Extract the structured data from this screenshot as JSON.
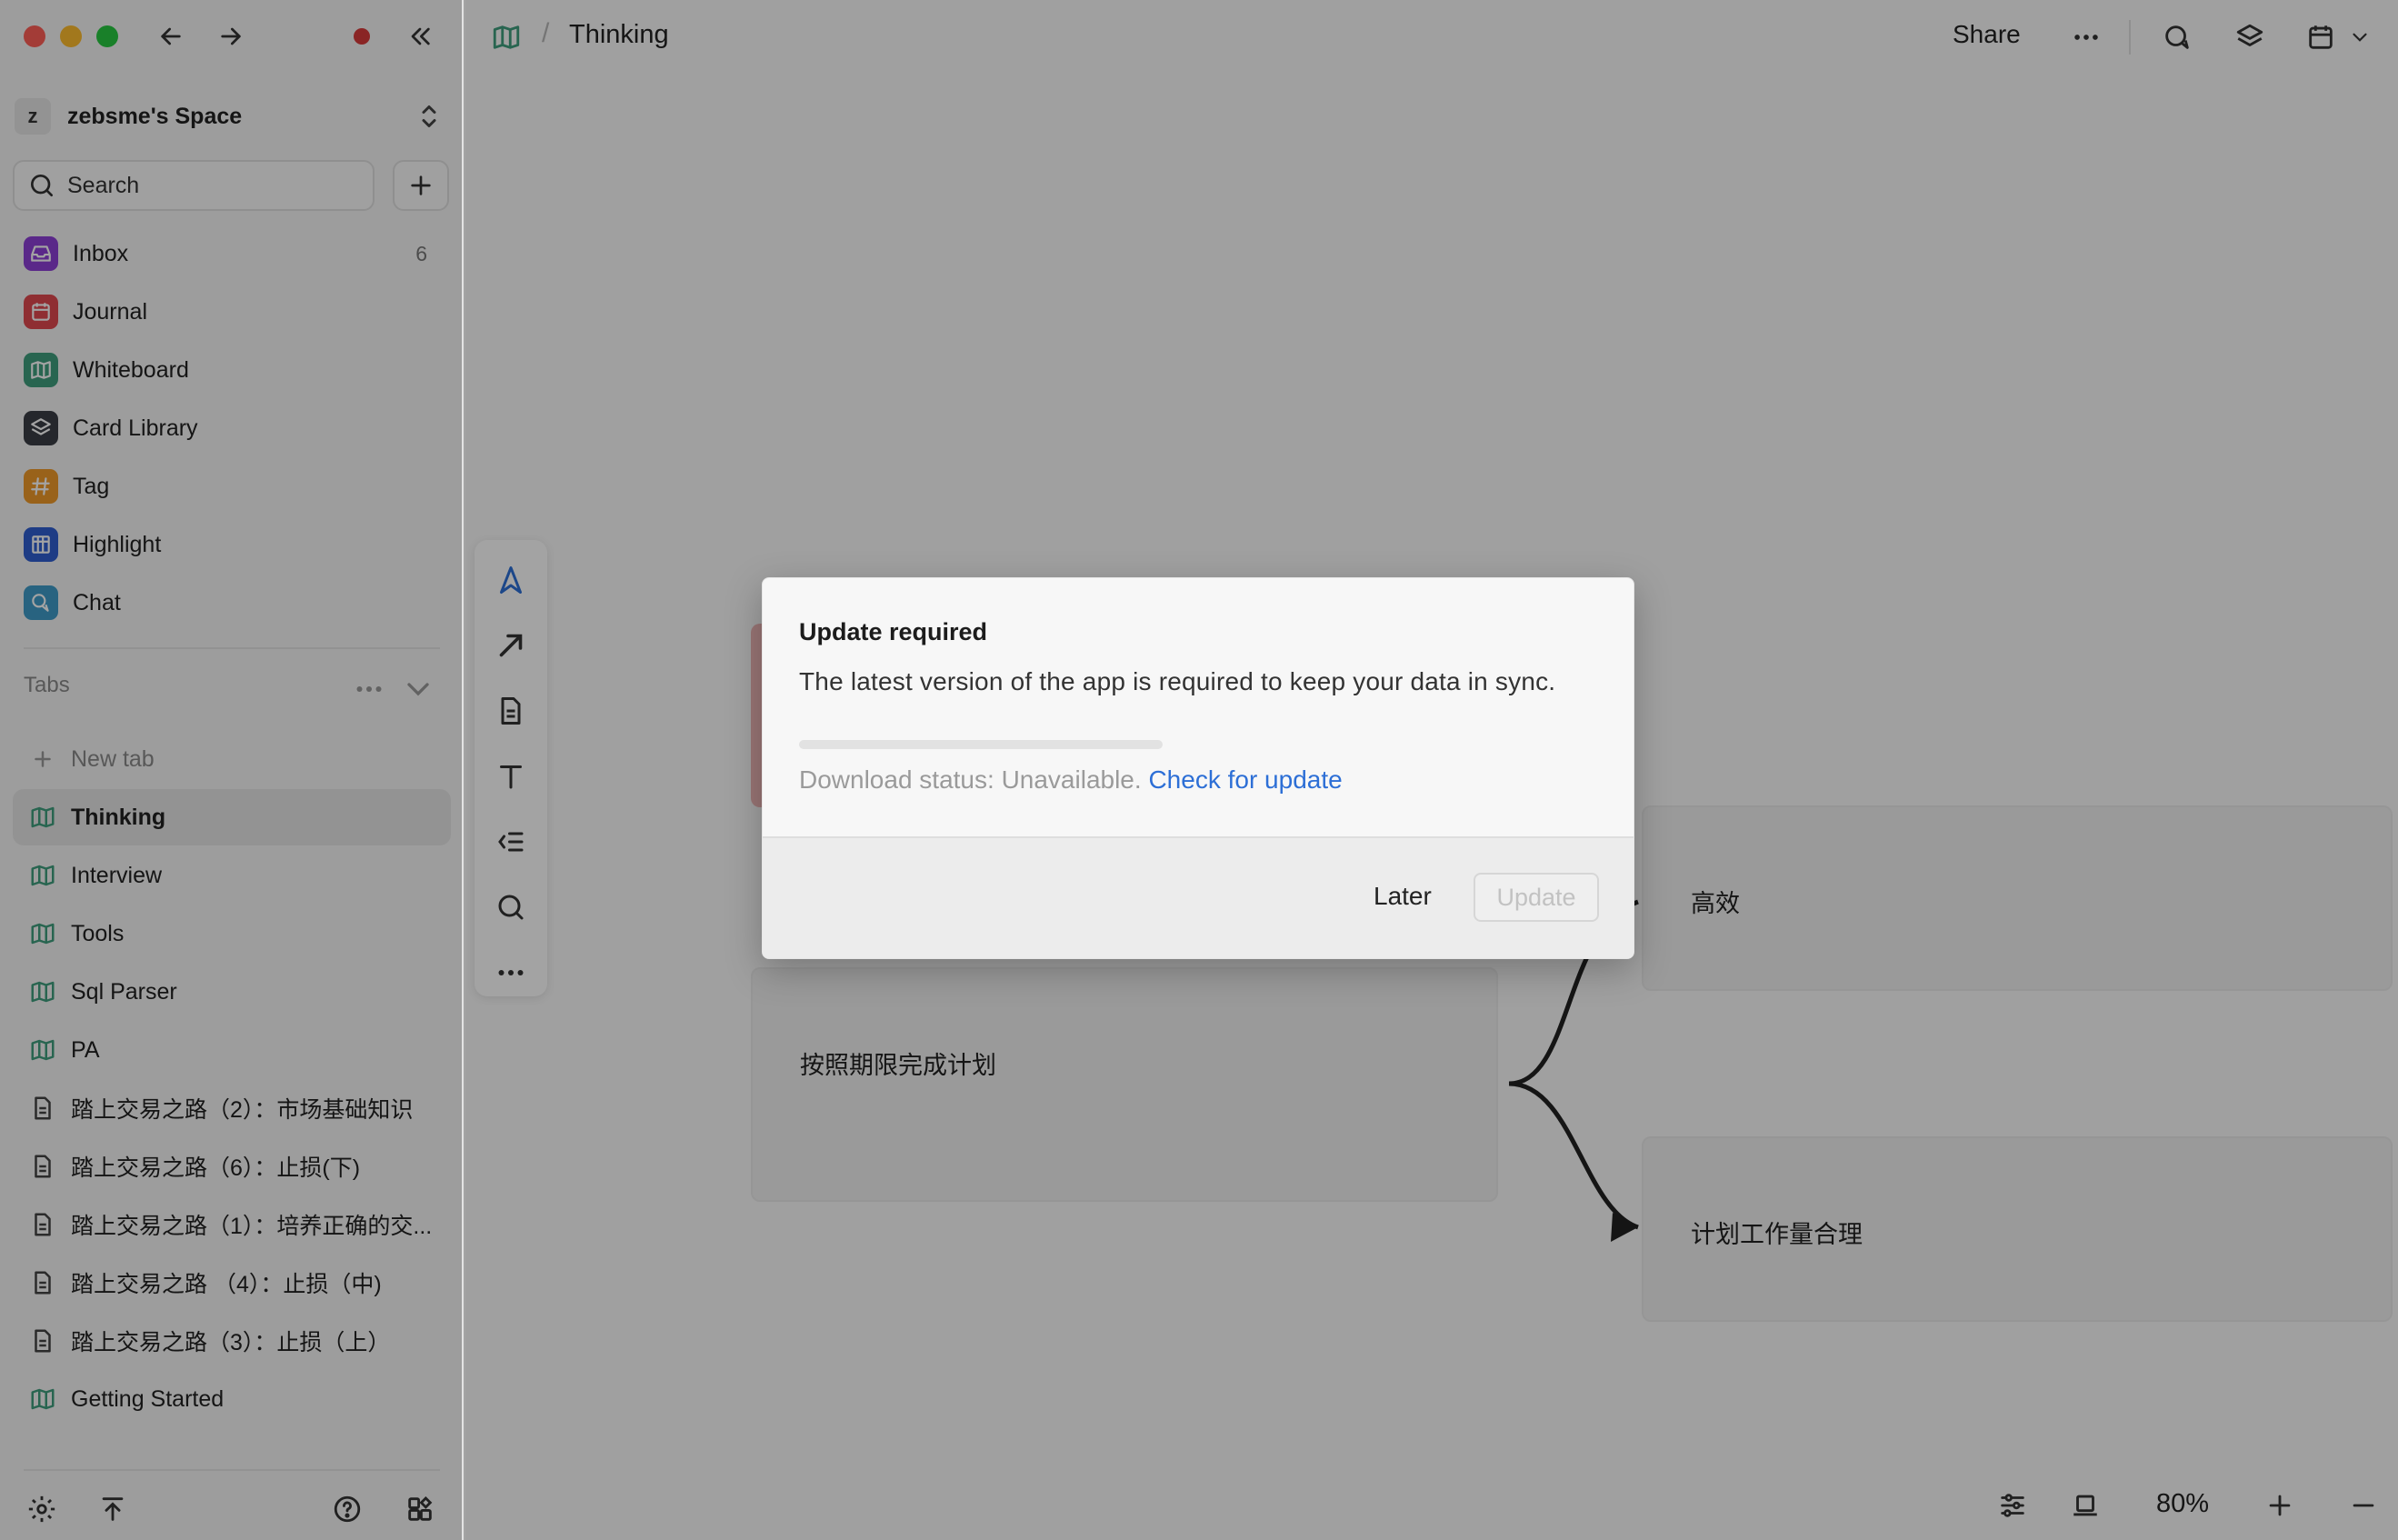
{
  "sidebar": {
    "space": {
      "avatar": "z",
      "name": "zebsme's Space"
    },
    "search": {
      "label": "Search"
    },
    "nav": [
      {
        "label": "Inbox",
        "count": "6",
        "icon": "inbox-icon",
        "color": "#8e3fd6"
      },
      {
        "label": "Journal",
        "count": "",
        "icon": "calendar-icon",
        "color": "#e0484f"
      },
      {
        "label": "Whiteboard",
        "count": "",
        "icon": "map-icon",
        "color": "#3f9e7e"
      },
      {
        "label": "Card Library",
        "count": "",
        "icon": "layers-icon",
        "color": "#3a3d45"
      },
      {
        "label": "Tag",
        "count": "",
        "icon": "hash-icon",
        "color": "#f09a2a"
      },
      {
        "label": "Highlight",
        "count": "",
        "icon": "highlight-icon",
        "color": "#2f5fd0"
      },
      {
        "label": "Chat",
        "count": "",
        "icon": "chat-icon",
        "color": "#3f9cc9"
      }
    ],
    "tabs_header": "Tabs",
    "new_tab": "New tab",
    "tabs": [
      {
        "label": "Thinking",
        "type": "whiteboard",
        "active": true
      },
      {
        "label": "Interview",
        "type": "whiteboard"
      },
      {
        "label": "Tools",
        "type": "whiteboard"
      },
      {
        "label": "Sql Parser",
        "type": "whiteboard"
      },
      {
        "label": "PA",
        "type": "whiteboard"
      },
      {
        "label": "踏上交易之路（2）：市场基础知识",
        "type": "document"
      },
      {
        "label": "踏上交易之路（6）：止损(下)",
        "type": "document"
      },
      {
        "label": "踏上交易之路（1）：培养正确的交...",
        "type": "document"
      },
      {
        "label": "踏上交易之路 （4）：止损（中)",
        "type": "document"
      },
      {
        "label": "踏上交易之路（3）：止损（上）",
        "type": "document"
      },
      {
        "label": "Getting Started",
        "type": "whiteboard"
      }
    ]
  },
  "header": {
    "breadcrumb_separator": "/",
    "title": "Thinking",
    "share_label": "Share"
  },
  "canvas": {
    "cards": [
      {
        "text": "按照期限完成计划"
      },
      {
        "text": "高效"
      },
      {
        "text": "计划工作量合理"
      }
    ]
  },
  "statusbar": {
    "zoom": "80%"
  },
  "modal": {
    "title": "Update required",
    "message": "The latest version of the app is required to keep your data in sync.",
    "progress": 0,
    "status_prefix": "Download status: Unavailable.",
    "check_link": "Check for update",
    "later_label": "Later",
    "update_label": "Update"
  },
  "colors": {
    "accent": "#2d6fd6",
    "whiteboard_icon": "#3f9e7e",
    "record_dot": "#d83b3b"
  }
}
